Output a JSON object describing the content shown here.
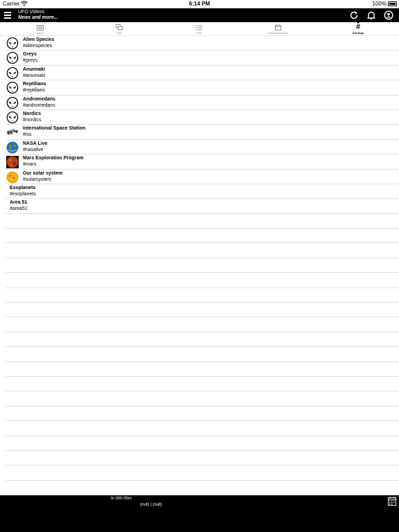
{
  "status_bar": {
    "carrier": "Carrier",
    "time": "6:14 PM",
    "battery": "100%"
  },
  "header": {
    "title": "UFO Videos",
    "subtitle": "News and more..."
  },
  "tabs": [
    {
      "label": "News",
      "icon": "newspaper-icon",
      "active": false
    },
    {
      "label": "Wall",
      "icon": "chat-bubbles-icon",
      "active": false
    },
    {
      "label": "Polls",
      "icon": "list-icon",
      "active": false
    },
    {
      "label": "Calendar/Events",
      "icon": "calendar-icon",
      "active": false
    },
    {
      "label": "InfoTags",
      "icon": "hashtag-icon",
      "glyph": "#",
      "active": true
    }
  ],
  "infotags": [
    {
      "title": "Alien Species",
      "tag": "#alienspecies",
      "image": "alien-head-icon"
    },
    {
      "title": "Greys",
      "tag": "#greys",
      "image": "alien-head-icon"
    },
    {
      "title": "Anunnaki",
      "tag": "#anunnaki",
      "image": "alien-head-icon"
    },
    {
      "title": "Reptilians",
      "tag": "#reptilians",
      "image": "alien-head-icon"
    },
    {
      "title": "Andromedans",
      "tag": "#andromedans",
      "image": "alien-head-icon"
    },
    {
      "title": "Nordics",
      "tag": "#nordics",
      "image": "alien-head-icon"
    },
    {
      "title": "International Space Station",
      "tag": "#iss",
      "image": "space-station-icon"
    },
    {
      "title": "NASA Live",
      "tag": "#nasalive",
      "image": "earth-icon"
    },
    {
      "title": "Mars Exploration Program",
      "tag": "#mars",
      "image": "mars-icon"
    },
    {
      "title": "Our solar system",
      "tag": "#solarsystem",
      "image": "sun-icon"
    },
    {
      "title": "Exoplanets",
      "tag": "#exoplanets",
      "image": ""
    },
    {
      "title": "Area 51",
      "tag": "#area51",
      "image": ""
    }
  ],
  "footer": {
    "timer": "In 00h 00m",
    "info": "(null) | (null)"
  }
}
